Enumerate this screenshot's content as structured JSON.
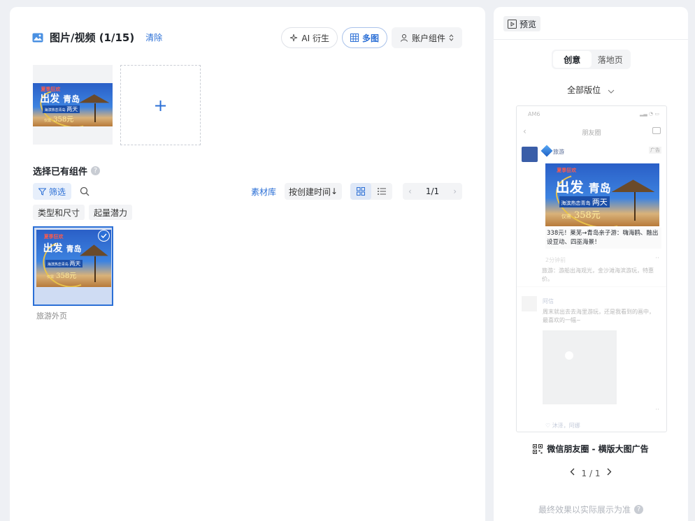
{
  "media": {
    "title": "图片/视频 (1/15)",
    "clear_label": "清除",
    "ai_label": "AI 衍生",
    "multi_label": "多图",
    "account_label": "账户组件",
    "add_symbol": "+"
  },
  "creative": {
    "top_text": "夏季狂欢",
    "headline": "出发",
    "city": "青岛",
    "sub": "海滨热恋青岛",
    "days": "两天",
    "price_prefix": "仅需",
    "price": "358元"
  },
  "components": {
    "title": "选择已有组件",
    "help": "?",
    "filter_label": "筛选",
    "library_label": "素材库",
    "sort_label": "按创建时间",
    "sort_arrow": "↓",
    "pager": {
      "prev": "‹",
      "text": "1/1",
      "next": "›"
    },
    "tags": [
      "类型和尺寸",
      "起量潜力"
    ],
    "asset_label": "旅游外页"
  },
  "preview": {
    "header": "预览",
    "tabs": [
      "创意",
      "落地页"
    ],
    "slot_select": "全部版位",
    "placement_name": "微信朋友圈 - 横版大图广告",
    "pager_text": "1 / 1",
    "footnote": "最终效果以实际展示为准",
    "footnote_help": "?"
  },
  "phone": {
    "status_time": "AM6",
    "status_right": "▂▃ ◔ ▭",
    "back": "‹",
    "title": "朋友圈",
    "account_name": "旅游",
    "ad_tag": "广告",
    "ad_text": "338元！莱芜→青岛亲子游：嗨海鸥、融出设豆动、四巫海景！",
    "time": "2分钟前",
    "dots": "··",
    "comment": "旅游：游船出海观光，金沙滩海滨游玩，特惠价。",
    "post_name": "阿信",
    "post_text": "周末就出去去海里游玩，还是我看到的画中，最喜欢的一幅~",
    "likes": "♡ 沐泽，阿娜"
  },
  "colors": {
    "accent": "#2b6fd6",
    "panel_bg": "#ffffff",
    "page_bg": "#eef0f4",
    "tag_bg": "#f3f4f6"
  },
  "icons": [
    "image-icon",
    "sparkle-icon",
    "grid-icon",
    "user-icon",
    "sort-updown-icon",
    "filter-icon",
    "search-icon",
    "grid-view-icon",
    "list-view-icon",
    "check-icon",
    "preview-icon",
    "chevron-down-icon",
    "qrcode-icon",
    "chevron-left-icon",
    "chevron-right-icon",
    "help-icon"
  ]
}
